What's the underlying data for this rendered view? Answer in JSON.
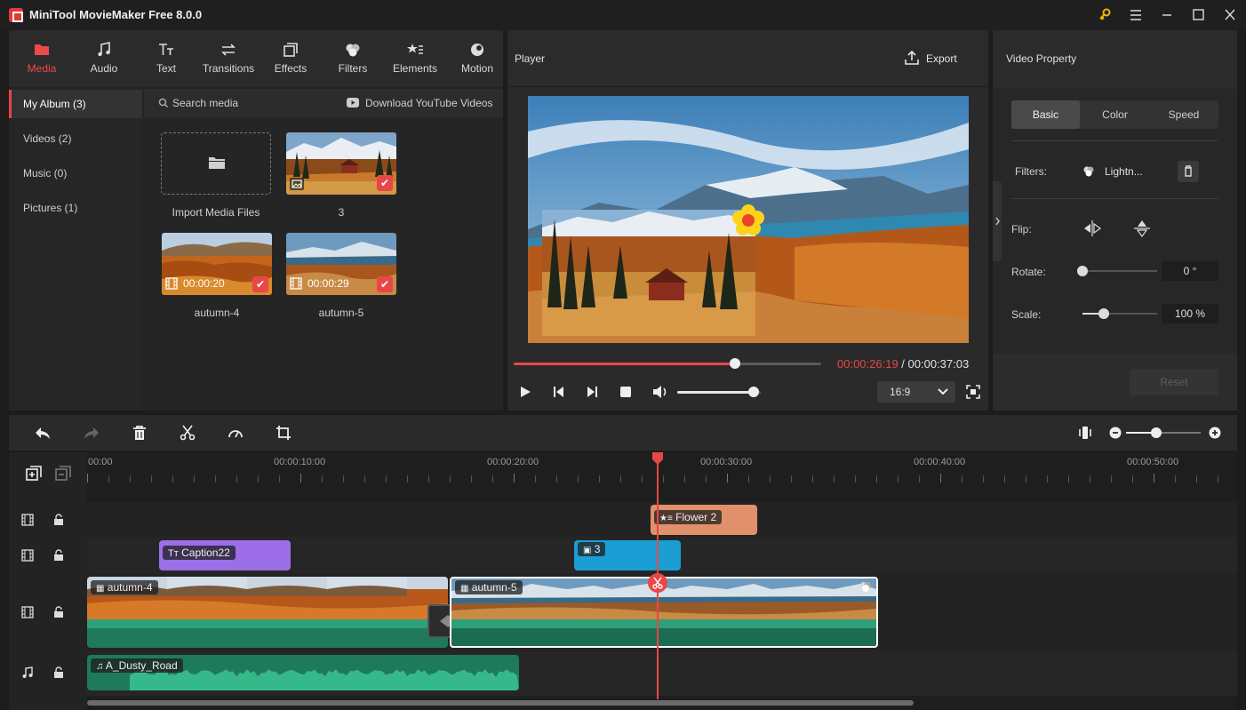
{
  "app": {
    "title": "MiniTool MovieMaker Free 8.0.0"
  },
  "colors": {
    "accent": "#e84747",
    "title_bg": "#1f1f1f",
    "panel_bg": "#2a2a2a",
    "clip_green": "#2a8f6a",
    "caption_purple": "#9c6ee8",
    "sticker_orange": "#e0906a",
    "image_blue": "#1a9ed4"
  },
  "media_tabs": [
    {
      "label": "Media",
      "icon": "folder-icon",
      "active": true
    },
    {
      "label": "Audio",
      "icon": "music-note-icon"
    },
    {
      "label": "Text",
      "icon": "text-icon"
    },
    {
      "label": "Transitions",
      "icon": "transition-icon"
    },
    {
      "label": "Effects",
      "icon": "effects-icon"
    },
    {
      "label": "Filters",
      "icon": "filters-icon"
    },
    {
      "label": "Elements",
      "icon": "elements-icon"
    },
    {
      "label": "Motion",
      "icon": "motion-icon"
    }
  ],
  "album": [
    {
      "label": "My Album (3)",
      "active": true
    },
    {
      "label": "Videos (2)"
    },
    {
      "label": "Music (0)"
    },
    {
      "label": "Pictures (1)"
    }
  ],
  "media": {
    "search_placeholder": "Search media",
    "download_label": "Download YouTube Videos",
    "import_label": "Import Media Files",
    "items": [
      {
        "label": "3",
        "type": "picture"
      },
      {
        "label": "autumn-4",
        "duration": "00:00:20",
        "type": "video"
      },
      {
        "label": "autumn-5",
        "duration": "00:00:29",
        "type": "video"
      }
    ]
  },
  "player": {
    "title": "Player",
    "export_label": "Export",
    "current_time": "00:00:26:19",
    "separator": " / ",
    "total_time": "00:00:37:03",
    "progress": 0.72,
    "volume": 0.92,
    "aspect": "16:9"
  },
  "property": {
    "title": "Video Property",
    "tabs": [
      "Basic",
      "Color",
      "Speed"
    ],
    "active_tab": "Basic",
    "filters_label": "Filters:",
    "filter_value": "Lightn...",
    "flip_label": "Flip:",
    "rotate_label": "Rotate:",
    "rotate_value": "0 °",
    "rotate_level": 0.0,
    "scale_label": "Scale:",
    "scale_value": "100 %",
    "scale_level": 0.29,
    "reset_label": "Reset"
  },
  "timeline": {
    "ruler": [
      "00:00",
      "00:00:10:00",
      "00:00:20:00",
      "00:00:30:00",
      "00:00:40:00",
      "00:00:50:00"
    ],
    "zoom_level": 0.4,
    "tracks": {
      "sticker": {
        "label": "Flower 2"
      },
      "text": {
        "caption_label": "Caption22",
        "image_label": "3"
      },
      "video": {
        "clip1_label": "autumn-4",
        "clip2_label": "autumn-5"
      },
      "music": {
        "label": "A_Dusty_Road"
      }
    }
  }
}
